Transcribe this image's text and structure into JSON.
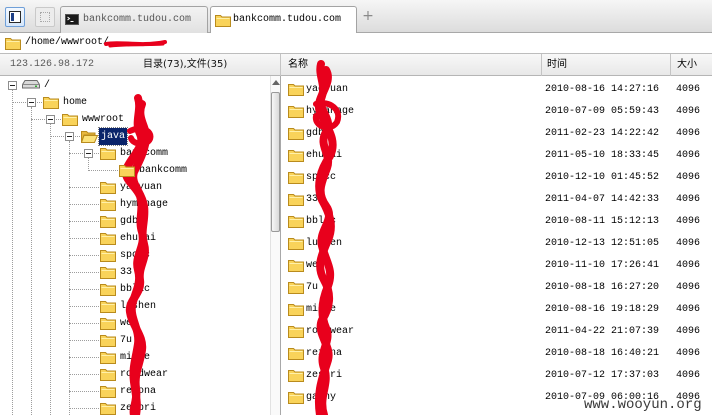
{
  "colors": {
    "selection": "#0a246a",
    "redaction": "#e8001c",
    "folder": "#f9d35a"
  },
  "toolbar": {
    "tabs": [
      {
        "label": "bankcomm.tudou.com",
        "icon": "terminal-icon",
        "active": false
      },
      {
        "label": "bankcomm.tudou.com",
        "icon": "folder-icon",
        "active": true
      }
    ],
    "new_tab_label": "+"
  },
  "address": {
    "path": "/home/wwwroot/",
    "icon": "folder-icon"
  },
  "info": {
    "ip": "123.126.98.172",
    "summary": "目录(73),文件(35)"
  },
  "columns": {
    "name": "名称",
    "time": "时间",
    "size": "大小"
  },
  "tree": [
    {
      "label": "/",
      "level": 0,
      "icon": "drive-icon",
      "expanded": true
    },
    {
      "label": "home",
      "level": 1,
      "icon": "folder-icon",
      "expanded": true
    },
    {
      "label": "wwwroot",
      "level": 2,
      "icon": "folder-icon",
      "expanded": true
    },
    {
      "label": "java",
      "level": 3,
      "icon": "folder-open-icon",
      "expanded": true,
      "selected": true
    },
    {
      "label": "bankcomm",
      "level": 4,
      "icon": "folder-icon",
      "expanded": true
    },
    {
      "label": "bankcomm",
      "level": 5,
      "icon": "folder-icon"
    },
    {
      "label": "yaoyuan",
      "level": 4,
      "icon": "folder-icon"
    },
    {
      "label": "hymanage",
      "level": 4,
      "icon": "folder-icon"
    },
    {
      "label": "gdb",
      "level": 4,
      "icon": "folder-icon"
    },
    {
      "label": "ehutai",
      "level": 4,
      "icon": "folder-icon"
    },
    {
      "label": "spccc",
      "level": 4,
      "icon": "folder-icon"
    },
    {
      "label": "33",
      "level": 4,
      "icon": "folder-icon"
    },
    {
      "label": "bblac",
      "level": 4,
      "icon": "folder-icon"
    },
    {
      "label": "lushen",
      "level": 4,
      "icon": "folder-icon"
    },
    {
      "label": "wei",
      "level": 4,
      "icon": "folder-icon"
    },
    {
      "label": "7u",
      "level": 4,
      "icon": "folder-icon"
    },
    {
      "label": "mione",
      "level": 4,
      "icon": "folder-icon"
    },
    {
      "label": "roadwear",
      "level": 4,
      "icon": "folder-icon"
    },
    {
      "label": "rezona",
      "level": 4,
      "icon": "folder-icon"
    },
    {
      "label": "zespri",
      "level": 4,
      "icon": "folder-icon"
    }
  ],
  "files": [
    {
      "name": "yaoyuan",
      "time": "2010-08-16 14:27:16",
      "size": "4096",
      "icon": "folder-icon"
    },
    {
      "name": "hymanage",
      "time": "2010-07-09 05:59:43",
      "size": "4096",
      "icon": "folder-icon"
    },
    {
      "name": "gdb",
      "time": "2011-02-23 14:22:42",
      "size": "4096",
      "icon": "folder-icon"
    },
    {
      "name": "ehutai",
      "time": "2011-05-10 18:33:45",
      "size": "4096",
      "icon": "folder-icon"
    },
    {
      "name": "spccc",
      "time": "2010-12-10 01:45:52",
      "size": "4096",
      "icon": "folder-icon"
    },
    {
      "name": "33",
      "time": "2011-04-07 14:42:33",
      "size": "4096",
      "icon": "folder-icon"
    },
    {
      "name": "bblac",
      "time": "2010-08-11 15:12:13",
      "size": "4096",
      "icon": "folder-icon"
    },
    {
      "name": "lushen",
      "time": "2010-12-13 12:51:05",
      "size": "4096",
      "icon": "folder-icon"
    },
    {
      "name": "wei",
      "time": "2010-11-10 17:26:41",
      "size": "4096",
      "icon": "folder-icon"
    },
    {
      "name": "7u",
      "time": "2010-08-18 16:27:20",
      "size": "4096",
      "icon": "folder-icon"
    },
    {
      "name": "mione",
      "time": "2010-08-16 19:18:29",
      "size": "4096",
      "icon": "folder-icon"
    },
    {
      "name": "roadwear",
      "time": "2011-04-22 21:07:39",
      "size": "4096",
      "icon": "folder-icon"
    },
    {
      "name": "rezona",
      "time": "2010-08-18 16:40:21",
      "size": "4096",
      "icon": "folder-icon"
    },
    {
      "name": "zespri",
      "time": "2010-07-12 17:37:03",
      "size": "4096",
      "icon": "folder-icon"
    },
    {
      "name": "gamny",
      "time": "2010-07-09 06:00:16",
      "size": "4096",
      "icon": "folder-icon"
    }
  ],
  "watermark": "www.wooyun.org"
}
